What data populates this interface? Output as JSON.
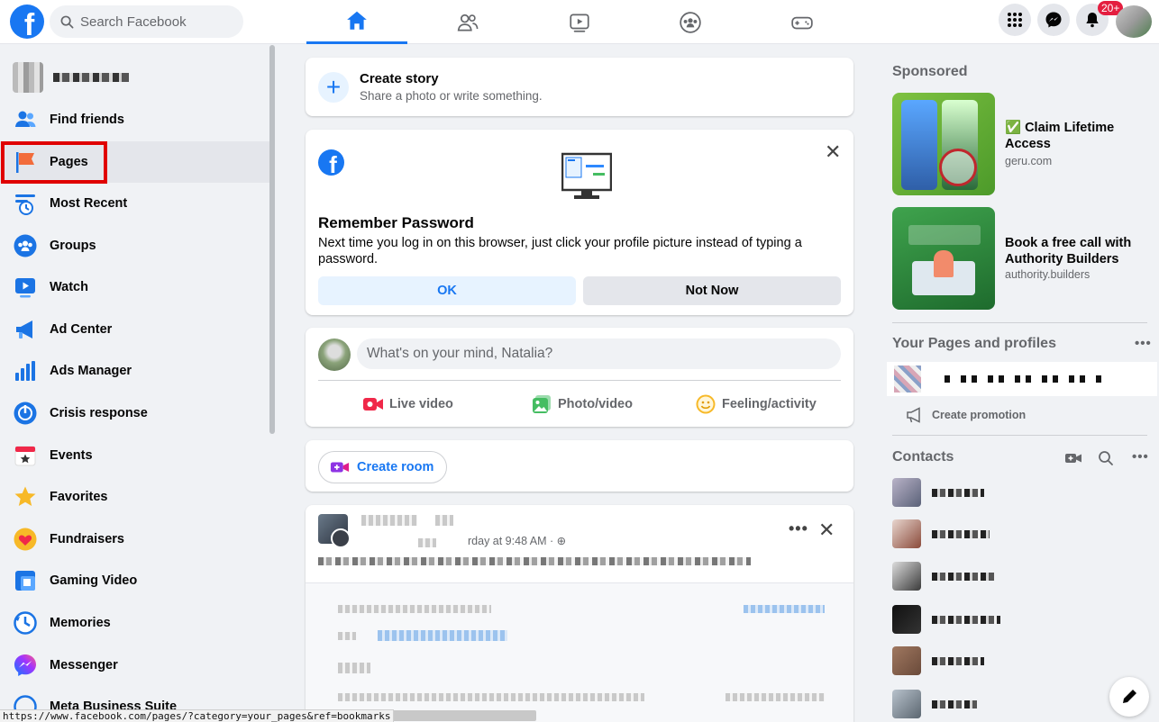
{
  "search": {
    "placeholder": "Search Facebook"
  },
  "brand": {
    "logo_letter": "f",
    "accent": "#1877f2"
  },
  "top_nav": {
    "tabs": [
      {
        "icon": "home-icon",
        "active": true
      },
      {
        "icon": "friends-icon",
        "active": false
      },
      {
        "icon": "watch-icon",
        "active": false
      },
      {
        "icon": "groups-icon",
        "active": false
      },
      {
        "icon": "gaming-icon",
        "active": false
      }
    ],
    "notifications_badge": "20+"
  },
  "sidebar": {
    "items": [
      {
        "label": "Find friends",
        "icon": "friends-icon"
      },
      {
        "label": "Pages",
        "icon": "pages-flag-icon"
      },
      {
        "label": "Most Recent",
        "icon": "most-recent-icon"
      },
      {
        "label": "Groups",
        "icon": "groups-icon"
      },
      {
        "label": "Watch",
        "icon": "watch-icon"
      },
      {
        "label": "Ad Center",
        "icon": "megaphone-icon"
      },
      {
        "label": "Ads Manager",
        "icon": "bar-chart-icon"
      },
      {
        "label": "Crisis response",
        "icon": "crisis-icon"
      },
      {
        "label": "Events",
        "icon": "calendar-star-icon"
      },
      {
        "label": "Favorites",
        "icon": "star-icon"
      },
      {
        "label": "Fundraisers",
        "icon": "heart-icon"
      },
      {
        "label": "Gaming Video",
        "icon": "gaming-video-icon"
      },
      {
        "label": "Memories",
        "icon": "clock-icon"
      },
      {
        "label": "Messenger",
        "icon": "messenger-icon"
      },
      {
        "label": "Meta Business Suite",
        "icon": "business-suite-icon"
      }
    ]
  },
  "story": {
    "title": "Create story",
    "subtitle": "Share a photo or write something."
  },
  "remember_password": {
    "title": "Remember Password",
    "text": "Next time you log in on this browser, just click your profile picture instead of typing a password.",
    "ok_label": "OK",
    "not_now_label": "Not Now",
    "close_glyph": "✕"
  },
  "composer": {
    "placeholder": "What's on your mind, Natalia?",
    "actions": [
      {
        "label": "Live video",
        "icon": "live-video-icon",
        "color": "#f02849"
      },
      {
        "label": "Photo/video",
        "icon": "photo-video-icon",
        "color": "#45bd62"
      },
      {
        "label": "Feeling/activity",
        "icon": "feeling-icon",
        "color": "#f7b928"
      }
    ]
  },
  "room": {
    "label": "Create room"
  },
  "post": {
    "timestamp": "rday at 9:48 AM · ",
    "more_glyph": "•••",
    "close_glyph": "✕"
  },
  "right": {
    "sponsored_heading": "Sponsored",
    "ads": [
      {
        "title": "✅ Claim Lifetime Access",
        "domain": "geru.com"
      },
      {
        "title": "Book a free call with Authority Builders",
        "domain": "authority.builders"
      }
    ],
    "pages_heading": "Your Pages and profiles",
    "create_promotion": "Create promotion",
    "contacts_heading": "Contacts",
    "more_glyph": "•••"
  },
  "status_url": "https://www.facebook.com/pages/?category=your_pages&ref=bookmarks"
}
